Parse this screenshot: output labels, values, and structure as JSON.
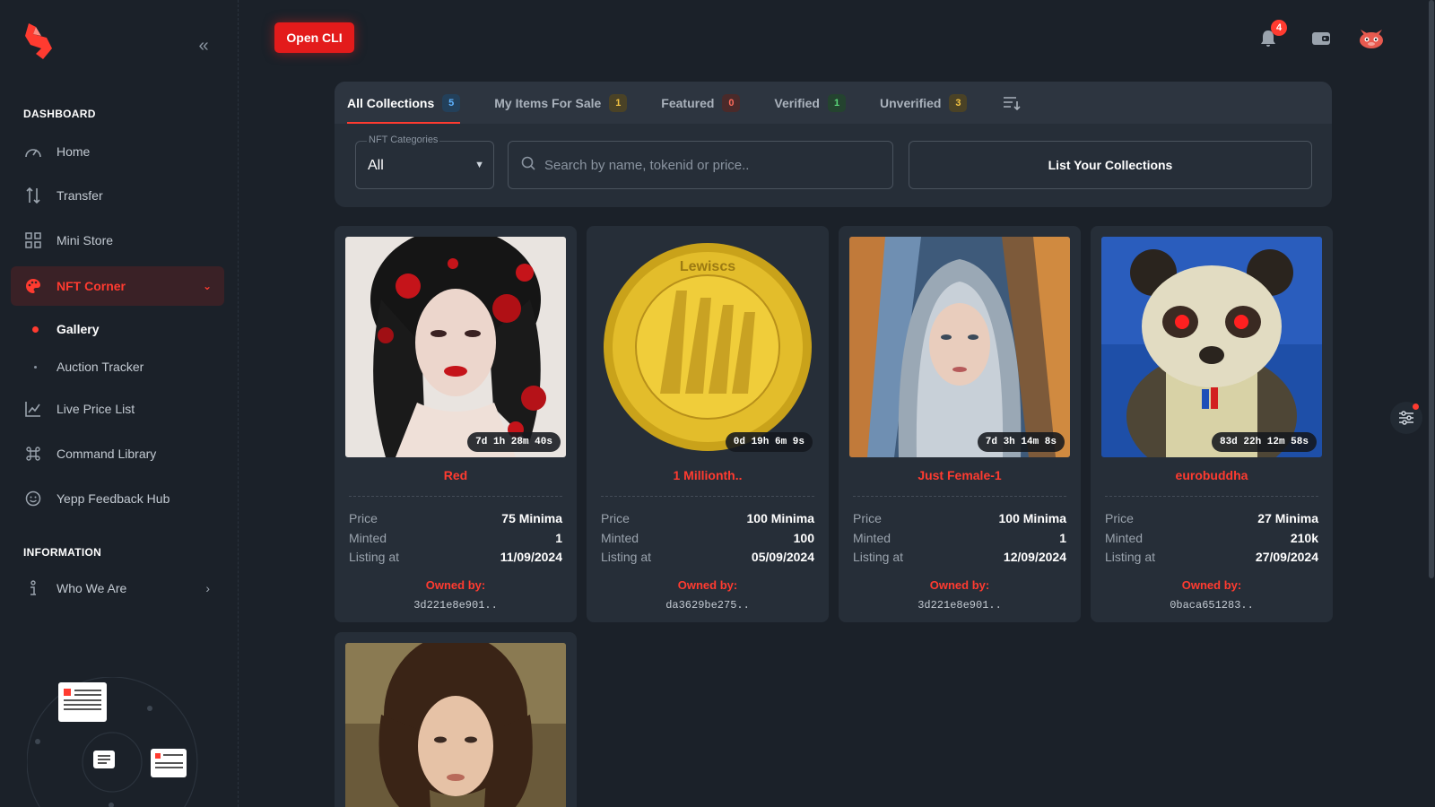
{
  "sidebar": {
    "sections": {
      "dashboard": "DASHBOARD",
      "information": "INFORMATION"
    },
    "items": {
      "home": {
        "label": "Home",
        "icon": "speedometer-icon"
      },
      "transfer": {
        "label": "Transfer",
        "icon": "transfer-icon"
      },
      "mini_store": {
        "label": "Mini Store",
        "icon": "grid-icon"
      },
      "nft_corner": {
        "label": "NFT Corner",
        "icon": "palette-icon"
      },
      "gallery": {
        "label": "Gallery"
      },
      "auction_tracker": {
        "label": "Auction Tracker"
      },
      "live_price_list": {
        "label": "Live Price List",
        "icon": "chart-icon"
      },
      "command_library": {
        "label": "Command Library",
        "icon": "command-icon"
      },
      "feedback_hub": {
        "label": "Yepp Feedback Hub",
        "icon": "smile-icon"
      },
      "who_we_are": {
        "label": "Who We Are",
        "icon": "info-icon"
      }
    }
  },
  "header": {
    "open_cli_label": "Open CLI",
    "notification_count": "4"
  },
  "tabs": [
    {
      "label": "All Collections",
      "count": "5",
      "active": true,
      "color": "blue"
    },
    {
      "label": "My Items For Sale",
      "count": "1",
      "color": "yellow"
    },
    {
      "label": "Featured",
      "count": "0",
      "color": "red"
    },
    {
      "label": "Verified",
      "count": "1",
      "color": "green"
    },
    {
      "label": "Unverified",
      "count": "3",
      "color": "yellow"
    }
  ],
  "filters": {
    "category_label": "NFT Categories",
    "category_value": "All",
    "search_placeholder": "Search by name, tokenid or price..",
    "list_button": "List Your Collections"
  },
  "card_labels": {
    "price": "Price",
    "minted": "Minted",
    "listing_at": "Listing at",
    "owned_by": "Owned by:"
  },
  "cards": [
    {
      "name": "Red",
      "timer": "7d 1h 28m 40s",
      "price": "75 Minima",
      "minted": "1",
      "listing_at": "11/09/2024",
      "owner": "3d221e8e901..",
      "coin_text": ""
    },
    {
      "name": "1 Millionth..",
      "timer": "0d 19h 6m 9s",
      "price": "100 Minima",
      "minted": "100",
      "listing_at": "05/09/2024",
      "owner": "da3629be275..",
      "coin_text": "Lewiscs"
    },
    {
      "name": "Just Female-1",
      "timer": "7d 3h 14m 8s",
      "price": "100 Minima",
      "minted": "1",
      "listing_at": "12/09/2024",
      "owner": "3d221e8e901..",
      "coin_text": ""
    },
    {
      "name": "eurobuddha",
      "timer": "83d 22h 12m 58s",
      "price": "27 Minima",
      "minted": "210k",
      "listing_at": "27/09/2024",
      "owner": "0baca651283..",
      "coin_text": ""
    }
  ],
  "colors": {
    "accent": "#ff3b30",
    "background": "#1b2129",
    "panel": "#262e38"
  }
}
